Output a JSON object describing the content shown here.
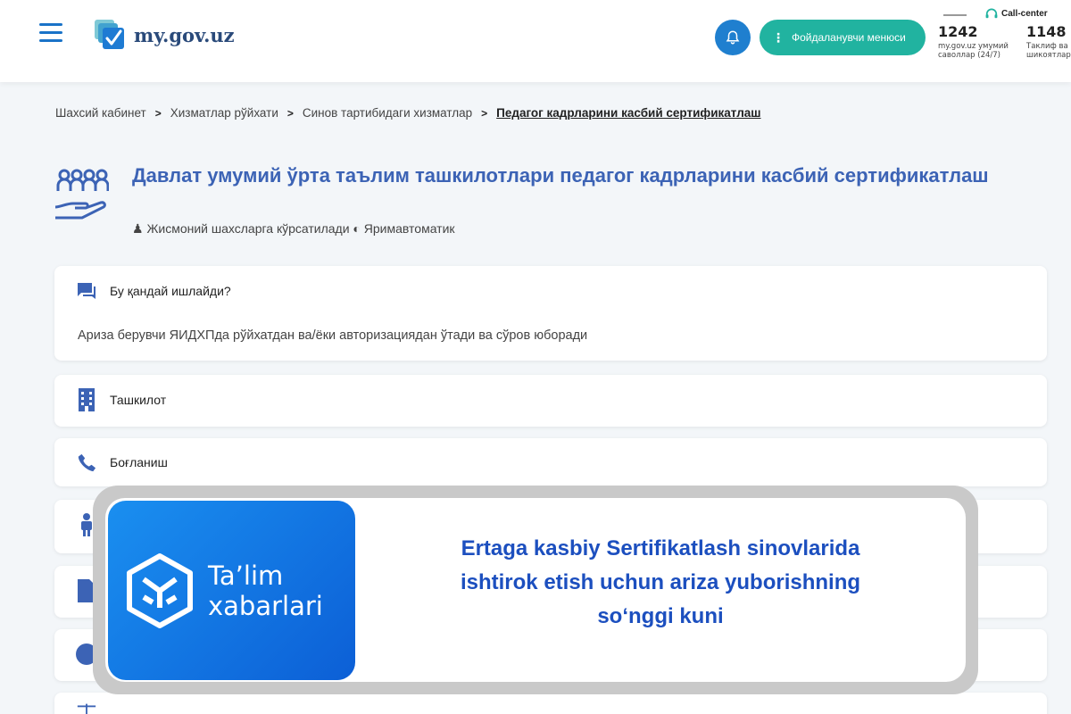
{
  "header": {
    "logo_text": "my.gov.uz",
    "user_menu_label": "Фойдаланувчи менюси",
    "call_center_label": "Call-center",
    "stats": [
      {
        "value": "1242",
        "caption_line1": "my.gov.uz умумий",
        "caption_line2": "саволлар (24/7)"
      },
      {
        "value": "1148",
        "caption_line1": "Таклиф ва",
        "caption_line2": "шикоятлар"
      }
    ]
  },
  "breadcrumb": {
    "items": [
      "Шахсий кабинет",
      "Хизматлар рўйхати",
      "Синов тартибидаги хизматлар"
    ],
    "current": "Педагог кадрларини касбий сертификатлаш"
  },
  "service": {
    "title": "Давлат умумий ўрта таълим ташкилотлари педагог кадрларини касбий сертификатлаш",
    "audience": "Жисмоний шахсларга кўрсатилади",
    "mode": "Яримавтоматик"
  },
  "sections": [
    {
      "label": "Бу қандай ишлайди?",
      "body": "Ариза берувчи ЯИДХПда рўйхатдан ва/ёки авторизациядан ўтади ва сўров юборади"
    },
    {
      "label": "Ташкилот"
    },
    {
      "label": "Боғланиш"
    }
  ],
  "overlay": {
    "brand_line1": "Ta’lim",
    "brand_line2": "xabarlari",
    "headline_line1": "Ertaga kasbiy Sertifikatlash sinovlarida",
    "headline_line2": "ishtirok etish uchun ariza yuborishning",
    "headline_line3": "so‘nggi kuni"
  },
  "colors": {
    "accent": "#3c63b5",
    "teal": "#21b3a0",
    "overlay_blue": "#0c5fd6"
  }
}
